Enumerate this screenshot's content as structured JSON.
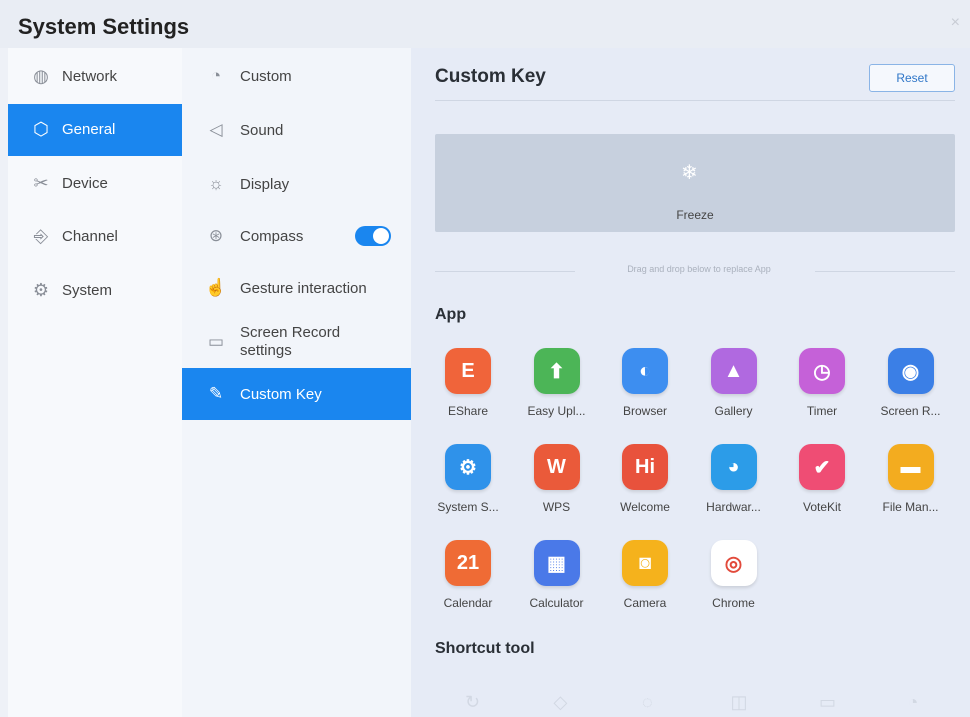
{
  "window": {
    "title": "System Settings",
    "close_glyph": "×"
  },
  "sidebar": {
    "items": [
      {
        "label": "Network",
        "icon": "globe-icon",
        "glyph": "◍"
      },
      {
        "label": "General",
        "icon": "cube-icon",
        "glyph": "⬡",
        "active": true
      },
      {
        "label": "Device",
        "icon": "scissors-icon",
        "glyph": "✂"
      },
      {
        "label": "Channel",
        "icon": "input-icon",
        "glyph": "⎆"
      },
      {
        "label": "System",
        "icon": "gear-icon",
        "glyph": "⚙"
      }
    ]
  },
  "subnav": {
    "items": [
      {
        "label": "Custom",
        "icon": "palette-icon",
        "glyph": "◔"
      },
      {
        "label": "Sound",
        "icon": "speaker-icon",
        "glyph": "◁"
      },
      {
        "label": "Display",
        "icon": "sun-icon",
        "glyph": "☼"
      },
      {
        "label": "Compass",
        "icon": "compass-icon",
        "glyph": "⊛",
        "toggle": true
      },
      {
        "label": "Gesture interaction",
        "icon": "hand-icon",
        "glyph": "☝"
      },
      {
        "label": "Screen Record settings",
        "icon": "record-icon",
        "glyph": "▭"
      },
      {
        "label": "Custom Key",
        "icon": "edit-icon",
        "glyph": "✎",
        "active": true
      }
    ]
  },
  "main": {
    "title": "Custom Key",
    "reset_label": "Reset",
    "freeze": {
      "label": "Freeze",
      "glyph": "❄"
    },
    "hint": "Drag and drop below to replace App",
    "app_section_title": "App",
    "shortcut_section_title": "Shortcut tool",
    "apps": [
      {
        "label": "EShare",
        "icon": "eshare-icon",
        "glyph": "E",
        "color": "#f0643a"
      },
      {
        "label": "Easy Upl...",
        "icon": "upload-icon",
        "glyph": "⬆",
        "color": "#4cb557"
      },
      {
        "label": "Browser",
        "icon": "browser-icon",
        "glyph": "◐",
        "color": "#3d8ef0"
      },
      {
        "label": "Gallery",
        "icon": "gallery-icon",
        "glyph": "▲",
        "color": "#b069e0"
      },
      {
        "label": "Timer",
        "icon": "timer-icon",
        "glyph": "◷",
        "color": "#c561d8"
      },
      {
        "label": "Screen R...",
        "icon": "screen-record-icon",
        "glyph": "◉",
        "color": "#3b7fe6"
      },
      {
        "label": "System S...",
        "icon": "settings-icon",
        "glyph": "⚙",
        "color": "#2f92ea"
      },
      {
        "label": "WPS",
        "icon": "wps-icon",
        "glyph": "W",
        "color": "#ea5a3a"
      },
      {
        "label": "Welcome",
        "icon": "welcome-icon",
        "glyph": "Hi",
        "color": "#e8523c"
      },
      {
        "label": "Hardwar...",
        "icon": "hardware-icon",
        "glyph": "◕",
        "color": "#2c9ce8"
      },
      {
        "label": "VoteKit",
        "icon": "votekit-icon",
        "glyph": "✔",
        "color": "#ef4d74"
      },
      {
        "label": "File Man...",
        "icon": "folder-icon",
        "glyph": "▬",
        "color": "#f3ac1f"
      },
      {
        "label": "Calendar",
        "icon": "calendar-icon",
        "glyph": "21",
        "color": "#ef6b35"
      },
      {
        "label": "Calculator",
        "icon": "calculator-icon",
        "glyph": "▦",
        "color": "#4a79e8"
      },
      {
        "label": "Camera",
        "icon": "camera-icon",
        "glyph": "◙",
        "color": "#f5b21c"
      },
      {
        "label": "Chrome",
        "icon": "chrome-icon",
        "glyph": "◎",
        "color": "#ffffff"
      }
    ],
    "shortcuts": [
      {
        "icon": "shortcut-icon-1",
        "glyph": "↻"
      },
      {
        "icon": "shortcut-icon-2",
        "glyph": "◇"
      },
      {
        "icon": "shortcut-icon-3",
        "glyph": "◌"
      },
      {
        "icon": "shortcut-icon-4",
        "glyph": "◫"
      },
      {
        "icon": "shortcut-icon-5",
        "glyph": "▭"
      },
      {
        "icon": "shortcut-icon-6",
        "glyph": "◔"
      }
    ]
  }
}
